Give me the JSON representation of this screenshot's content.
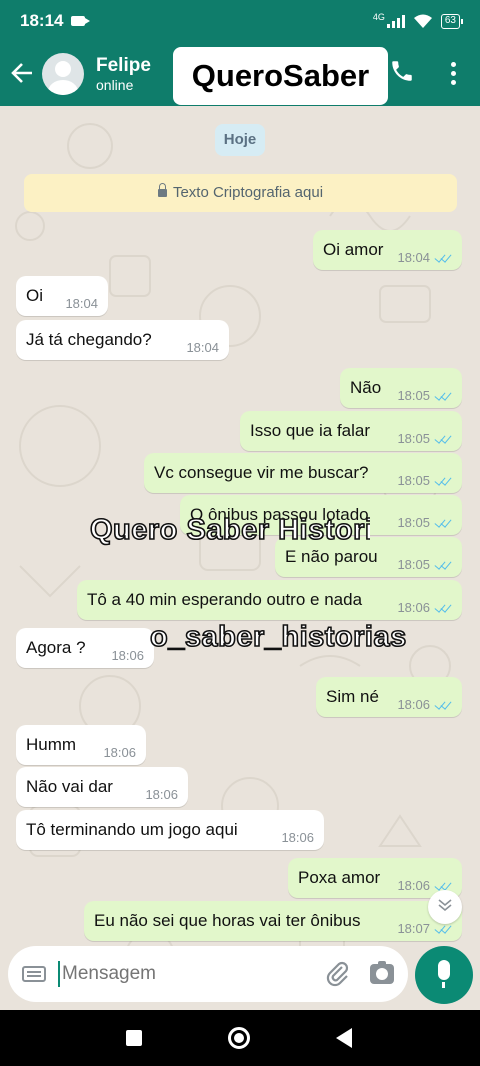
{
  "status_bar": {
    "time": "18:14",
    "network": "4G",
    "battery": "63"
  },
  "header": {
    "contact_name": "Felipe",
    "contact_status": "online",
    "overlay_title": "QueroSaber"
  },
  "chat": {
    "date_chip": "Hoje",
    "encryption_notice": "Texto Criptografia aqui",
    "messages": [
      {
        "dir": "out",
        "text": "Oi amor",
        "time": "18:04"
      },
      {
        "dir": "in",
        "text": "Oi",
        "time": "18:04"
      },
      {
        "dir": "in",
        "text": "Já tá chegando?",
        "time": "18:04"
      },
      {
        "dir": "out",
        "text": "Não",
        "time": "18:05"
      },
      {
        "dir": "out",
        "text": "Isso que ia falar",
        "time": "18:05"
      },
      {
        "dir": "out",
        "text": "Vc consegue vir me buscar?",
        "time": "18:05"
      },
      {
        "dir": "out",
        "text": "O ônibus passou lotado",
        "time": "18:05"
      },
      {
        "dir": "out",
        "text": "E não parou",
        "time": "18:05"
      },
      {
        "dir": "out",
        "text": "Tô a 40 min esperando outro e nada",
        "time": "18:06"
      },
      {
        "dir": "in",
        "text": "Agora ?",
        "time": "18:06"
      },
      {
        "dir": "out",
        "text": "Sim né",
        "time": "18:06"
      },
      {
        "dir": "in",
        "text": "Humm",
        "time": "18:06"
      },
      {
        "dir": "in",
        "text": "Não vai dar",
        "time": "18:06"
      },
      {
        "dir": "in",
        "text": "Tô terminando um jogo aqui",
        "time": "18:06"
      },
      {
        "dir": "out",
        "text": "Poxa amor",
        "time": "18:06"
      },
      {
        "dir": "out",
        "text": "Eu não sei que horas vai ter ônibus",
        "time": "18:07"
      }
    ],
    "watermark_1": "Quero Saber Historias",
    "watermark_2": "o_saber_historias"
  },
  "composer": {
    "placeholder": "Mensagem"
  },
  "colors": {
    "header": "#0f7d6b",
    "outgoing": "#e2f7cb",
    "incoming": "#ffffff",
    "accent": "#0b8a74",
    "read_ticks": "#53bdeb"
  },
  "icons": [
    "back-arrow-icon",
    "phone-icon",
    "more-vert-icon",
    "lock-icon",
    "keyboard-icon",
    "attach-icon",
    "camera-icon",
    "mic-icon",
    "double-chevron-down-icon"
  ]
}
